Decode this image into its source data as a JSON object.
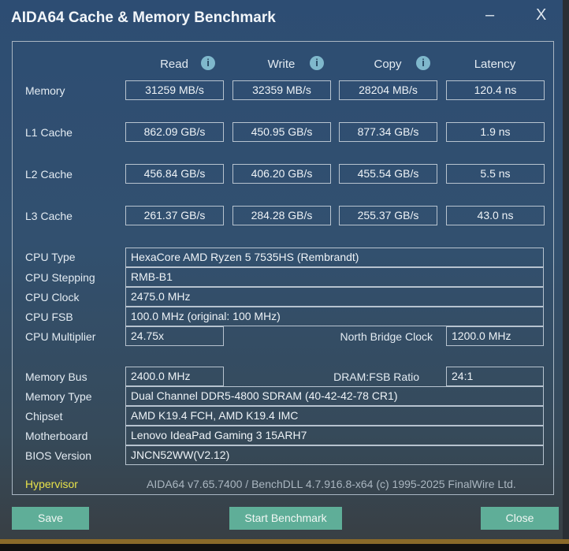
{
  "window": {
    "title": "AIDA64 Cache & Memory Benchmark",
    "minimize": "–",
    "close": "X"
  },
  "columns": [
    {
      "label": "Read",
      "info": "i"
    },
    {
      "label": "Write",
      "info": "i"
    },
    {
      "label": "Copy",
      "info": "i"
    },
    {
      "label": "Latency"
    }
  ],
  "bench": [
    {
      "label": "Memory",
      "values": [
        "31259 MB/s",
        "32359 MB/s",
        "28204 MB/s",
        "120.4 ns"
      ]
    },
    {
      "label": "L1 Cache",
      "values": [
        "862.09 GB/s",
        "450.95 GB/s",
        "877.34 GB/s",
        "1.9 ns"
      ]
    },
    {
      "label": "L2 Cache",
      "values": [
        "456.84 GB/s",
        "406.20 GB/s",
        "455.54 GB/s",
        "5.5 ns"
      ]
    },
    {
      "label": "L3 Cache",
      "values": [
        "261.37 GB/s",
        "284.28 GB/s",
        "255.37 GB/s",
        "43.0 ns"
      ]
    }
  ],
  "cpu": {
    "type": {
      "label": "CPU Type",
      "value": "HexaCore AMD Ryzen 5 7535HS  (Rembrandt)"
    },
    "stepping": {
      "label": "CPU Stepping",
      "value": "RMB-B1"
    },
    "clock": {
      "label": "CPU Clock",
      "value": "2475.0 MHz"
    },
    "fsb": {
      "label": "CPU FSB",
      "value": "100.0 MHz  (original: 100 MHz)"
    },
    "multiplier": {
      "label": "CPU Multiplier",
      "value": "24.75x"
    },
    "nb_clock": {
      "label": "North Bridge Clock",
      "value": "1200.0 MHz"
    }
  },
  "memory": {
    "bus": {
      "label": "Memory Bus",
      "value": "2400.0 MHz"
    },
    "ratio": {
      "label": "DRAM:FSB Ratio",
      "value": "24:1"
    },
    "type": {
      "label": "Memory Type",
      "value": "Dual Channel DDR5-4800 SDRAM  (40-42-42-78 CR1)"
    },
    "chipset": {
      "label": "Chipset",
      "value": "AMD K19.4 FCH, AMD K19.4 IMC"
    },
    "motherboard": {
      "label": "Motherboard",
      "value": "Lenovo IdeaPad Gaming 3 15ARH7"
    },
    "bios": {
      "label": "BIOS Version",
      "value": "JNCN52WW(V2.12)"
    }
  },
  "footer": {
    "hypervisor": "Hypervisor",
    "version": "AIDA64 v7.65.7400 / BenchDLL 4.7.916.8-x64  (c) 1995-2025 FinalWire Ltd."
  },
  "buttons": {
    "save": "Save",
    "start": "Start Benchmark",
    "close": "Close"
  },
  "colors": {
    "accent": "#5fae98",
    "hypervisor": "#e8e24a"
  }
}
